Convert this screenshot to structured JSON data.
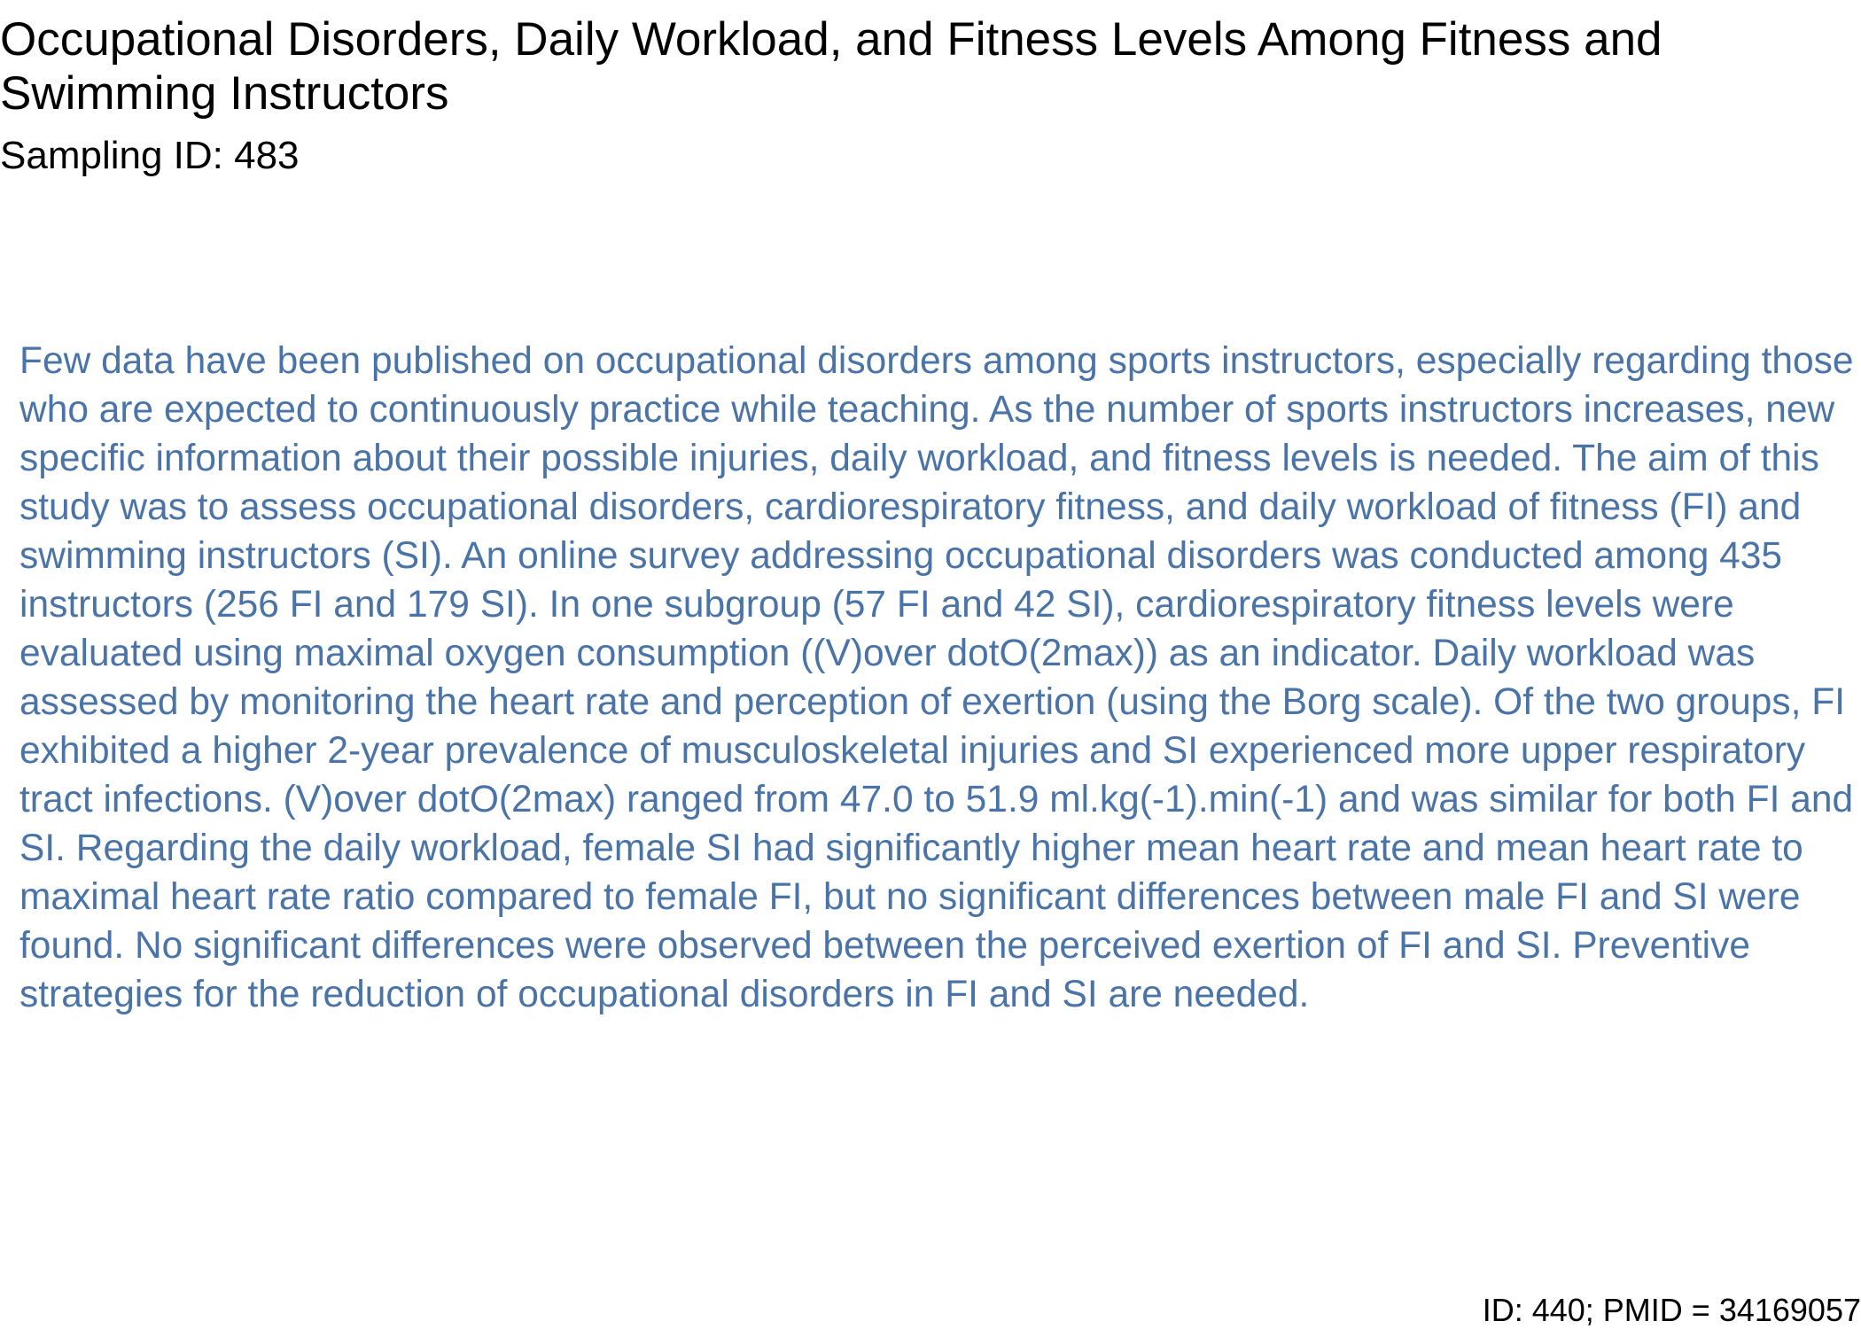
{
  "document": {
    "title": "Occupational Disorders, Daily Workload, and Fitness Levels Among Fitness and Swimming Instructors",
    "sampling_id": "Sampling ID: 483",
    "abstract": "Few data have been published on occupational disorders among sports instructors, especially regarding those who are expected to continuously practice while teaching. As the number of sports instructors increases, new specific information about their possible injuries, daily workload, and fitness levels is needed. The aim of this study was to assess occupational disorders, cardiorespiratory fitness, and daily workload of fitness (FI) and swimming instructors (SI). An online survey addressing occupational disorders was conducted among 435 instructors (256 FI and 179 SI). In one subgroup (57 FI and 42 SI), cardiorespiratory fitness levels were evaluated using maximal oxygen consumption ((V)over dotO(2max)) as an indicator. Daily workload was assessed by monitoring the heart rate and perception of exertion (using the Borg scale). Of the two groups, FI exhibited a higher 2-year prevalence of musculoskeletal injuries and SI experienced more upper respiratory tract infections. (V)over dotO(2max) ranged from 47.0 to 51.9 ml.kg(-1).min(-1) and was similar for both FI and SI. Regarding the daily workload, female SI had significantly higher mean heart rate and mean heart rate to maximal heart rate ratio compared to female FI, but no significant differences between male FI and SI were found. No significant differences were observed between the perceived exertion of FI and SI. Preventive strategies for the reduction of occupational disorders in FI and SI are needed.",
    "footer_id": "ID: 440; PMID = 34169057"
  },
  "colors": {
    "title_text": "#000000",
    "abstract_text": "#4a74a8"
  }
}
